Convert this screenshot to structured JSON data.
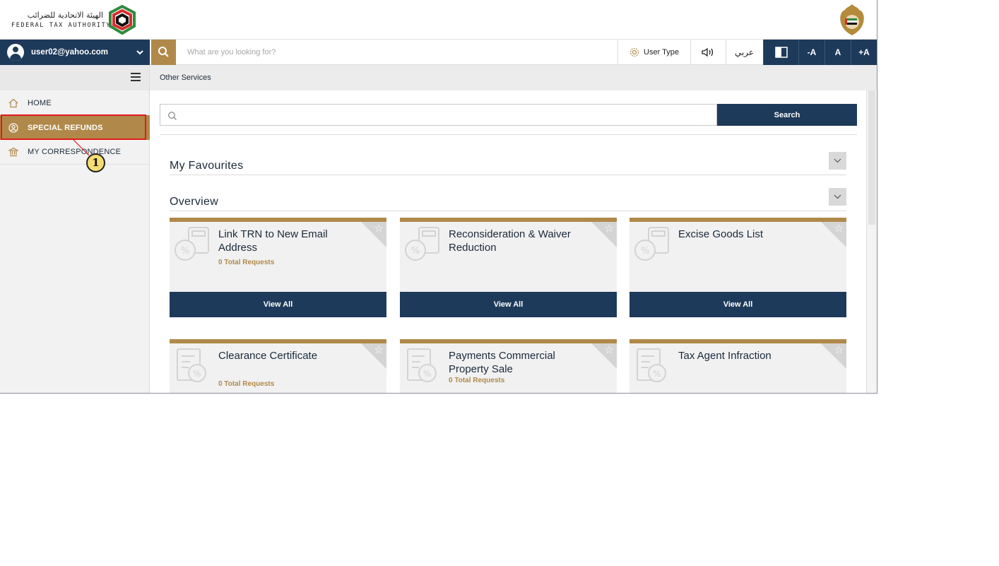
{
  "brand": {
    "arabic_name": "الهيئة الاتحادية للضرائب",
    "english_name": "FEDERAL TAX AUTHORITY"
  },
  "toolbar": {
    "user_email": "user02@yahoo.com",
    "search_placeholder": "What are you looking for?",
    "user_type_label": "User Type",
    "language_label": "عربي",
    "font_decrease": "-A",
    "font_reset": "A",
    "font_increase": "+A"
  },
  "sidebar": {
    "items": [
      {
        "label": "HOME",
        "icon": "home-icon",
        "active": false
      },
      {
        "label": "SPECIAL REFUNDS",
        "icon": "user-circle-icon",
        "active": true
      },
      {
        "label": "MY CORRESPONDENCE",
        "icon": "bank-icon",
        "active": false
      }
    ]
  },
  "annotation": {
    "number": "1"
  },
  "breadcrumb": "Other Services",
  "main": {
    "search_button": "Search",
    "favourites_title": "My Favourites",
    "overview_title": "Overview",
    "cards": [
      {
        "title": "Link TRN to New Email Address",
        "count": "0 Total Requests",
        "action": "View All",
        "icon": "calculator-percent-icon"
      },
      {
        "title": "Reconsideration & Waiver Reduction",
        "count": "",
        "action": "View All",
        "icon": "calculator-percent-icon"
      },
      {
        "title": "Excise Goods List",
        "count": "",
        "action": "View All",
        "icon": "calculator-percent-icon"
      },
      {
        "title": "Clearance Certificate",
        "count": "0 Total Requests",
        "action": "",
        "icon": "document-percent-icon"
      },
      {
        "title": "Payments Commercial Property Sale",
        "count": "0 Total Requests",
        "action": "",
        "icon": "document-percent-icon"
      },
      {
        "title": "Tax Agent Infraction",
        "count": "",
        "action": "",
        "icon": "document-percent-icon"
      }
    ]
  },
  "colors": {
    "navy": "#1e3a5a",
    "gold": "#b0894a",
    "highlight_red": "#e01b1b",
    "callout_yellow": "#f4dd72"
  }
}
